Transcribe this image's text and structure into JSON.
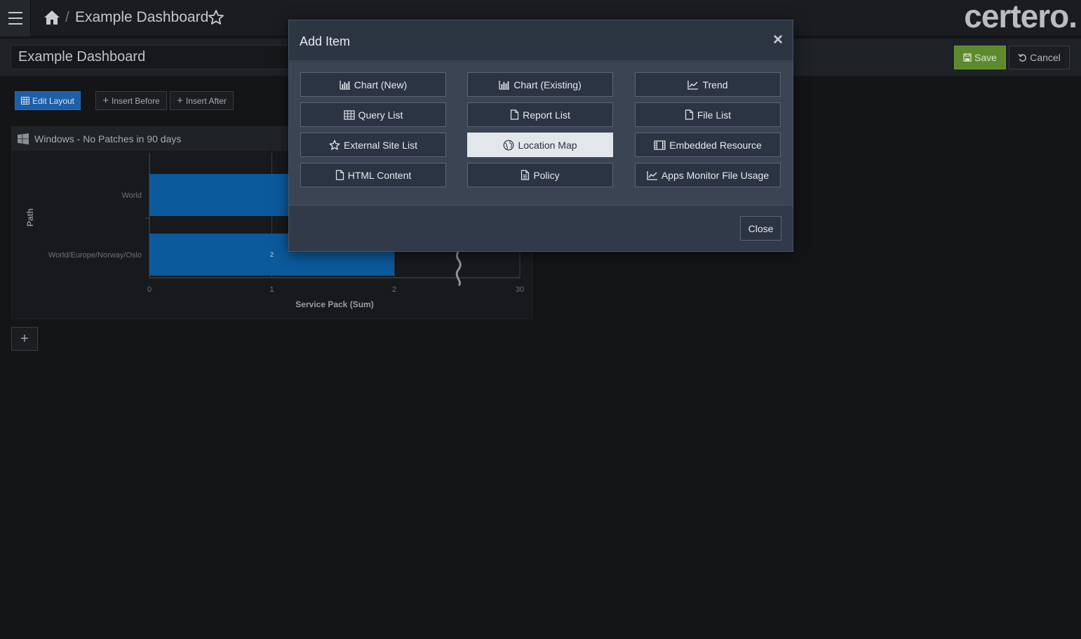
{
  "topbar": {
    "breadcrumb_sep": "/",
    "title": "Example Dashboard",
    "brand": "certero."
  },
  "titlebar": {
    "dashboard_name": "Example Dashboard",
    "save_label": "Save",
    "cancel_label": "Cancel"
  },
  "toolbar": {
    "edit_layout": "Edit Layout",
    "insert_before": "Insert Before",
    "insert_after": "Insert After"
  },
  "widget": {
    "title": "Windows - No Patches in 90 days",
    "add_label": "+"
  },
  "chart_data": {
    "type": "bar",
    "orientation": "horizontal",
    "categories": [
      "World",
      "World/Europe/Norway/Oslo"
    ],
    "values": [
      30,
      2
    ],
    "data_labels": [
      "",
      "2"
    ],
    "ylabel": "Path",
    "xlabel": "Service Pack (Sum)",
    "x_ticks": [
      "0",
      "1",
      "2",
      "30"
    ],
    "axis_break": true,
    "bar_color": "#0b5a9c"
  },
  "modal": {
    "title": "Add Item",
    "close_x": "×",
    "close_label": "Close",
    "options": [
      {
        "label": "Chart (New)",
        "icon": "bar-chart-icon"
      },
      {
        "label": "Chart (Existing)",
        "icon": "bar-chart-icon"
      },
      {
        "label": "Trend",
        "icon": "line-chart-icon"
      },
      {
        "label": "Query List",
        "icon": "table-icon"
      },
      {
        "label": "Report List",
        "icon": "document-icon"
      },
      {
        "label": "File List",
        "icon": "document-icon"
      },
      {
        "label": "External Site List",
        "icon": "star-icon"
      },
      {
        "label": "Location Map",
        "icon": "globe-icon",
        "active": true
      },
      {
        "label": "Embedded Resource",
        "icon": "film-icon"
      },
      {
        "label": "HTML Content",
        "icon": "document-icon"
      },
      {
        "label": "Policy",
        "icon": "document-text-icon"
      },
      {
        "label": "Apps Monitor File Usage",
        "icon": "line-chart-icon"
      }
    ]
  },
  "colors": {
    "accent_blue": "#1d5fa8",
    "save_green": "#5d8a2f",
    "bar_blue": "#0b5a9c"
  }
}
